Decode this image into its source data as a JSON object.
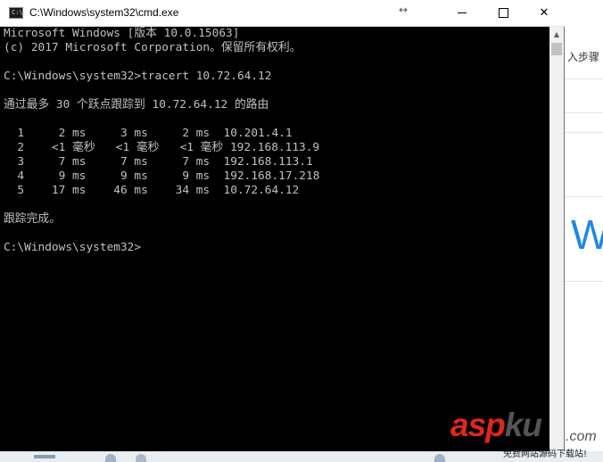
{
  "background_page": {
    "top_text": "入步骤",
    "large_letter": "W"
  },
  "window": {
    "title": "C:\\Windows\\system32\\cmd.exe",
    "icon_text": "C:\\_",
    "resize_glyph": "↔",
    "minimize_icon": "minimize-icon",
    "maximize_icon": "maximize-icon",
    "close_label": "✕"
  },
  "console": {
    "lines": [
      "Microsoft Windows [版本 10.0.15063]",
      "(c) 2017 Microsoft Corporation。保留所有权利。",
      "",
      "C:\\Windows\\system32>tracert 10.72.64.12",
      "",
      "通过最多 30 个跃点跟踪到 10.72.64.12 的路由",
      "",
      "  1     2 ms     3 ms     2 ms  10.201.4.1",
      "  2    <1 毫秒   <1 毫秒   <1 毫秒 192.168.113.9",
      "  3     7 ms     7 ms     7 ms  192.168.113.1",
      "  4     9 ms     9 ms     9 ms  192.168.17.218",
      "  5    17 ms    46 ms    34 ms  10.72.64.12",
      "",
      "跟踪完成。",
      "",
      "C:\\Windows\\system32>"
    ]
  },
  "scrollbar": {
    "up_arrow": "▲"
  },
  "watermark": {
    "brand_a": "asp",
    "brand_b": "ku",
    "domain": ".com",
    "subtitle": "免费网站源码下载站!"
  }
}
